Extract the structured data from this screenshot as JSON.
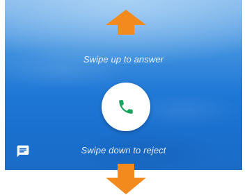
{
  "incoming_call": {
    "swipe_up_hint": "Swipe up to answer",
    "swipe_down_hint": "Swipe down to reject",
    "answer_icon": "phone-icon",
    "message_icon": "message-icon"
  },
  "annotations": {
    "up_arrow_icon": "arrow-up-icon",
    "down_arrow_icon": "arrow-down-icon",
    "arrow_color": "#f28a1d"
  },
  "colors": {
    "phone_icon": "#1aa260",
    "background_top": "#7fb5ea",
    "background_bottom": "#1a6cc7"
  }
}
